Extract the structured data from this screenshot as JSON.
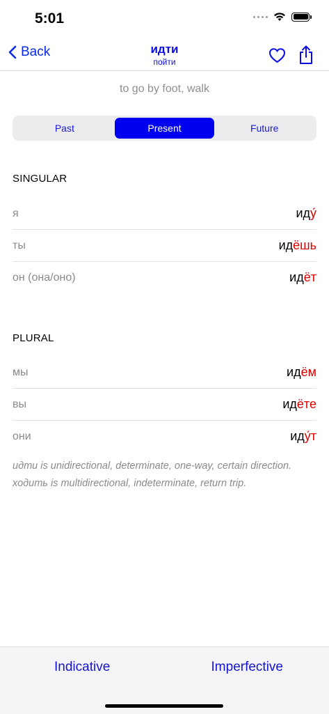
{
  "status": {
    "time": "5:01"
  },
  "nav": {
    "back_label": "Back",
    "title": "идти",
    "subtitle": "пойти"
  },
  "translation": "to go by foot, walk",
  "tenses": [
    "Past",
    "Present",
    "Future"
  ],
  "selected_tense": "Present",
  "singular": {
    "title": "SINGULAR",
    "rows": [
      {
        "pronoun": "я",
        "stem": "ид",
        "ending": "у́"
      },
      {
        "pronoun": "ты",
        "stem": "ид",
        "ending": "ёшь"
      },
      {
        "pronoun": "он (она/оно)",
        "stem": "ид",
        "ending": "ёт"
      }
    ]
  },
  "plural": {
    "title": "PLURAL",
    "rows": [
      {
        "pronoun": "мы",
        "stem": "ид",
        "ending": "ём"
      },
      {
        "pronoun": "вы",
        "stem": "ид",
        "ending": "ёте"
      },
      {
        "pronoun": "они",
        "stem": "ид",
        "ending": "у́т"
      }
    ]
  },
  "note": {
    "line1": "идти is unidirectional, determinate, one-way, certain direction.",
    "line2": "ходить is multidirectional, indeterminate, return trip."
  },
  "bottom": {
    "left_label": "Indicative",
    "right_label": "Imperfective"
  },
  "colors": {
    "accent": "#0000f0",
    "ending": "#e00000",
    "muted": "#8a8a8e"
  }
}
